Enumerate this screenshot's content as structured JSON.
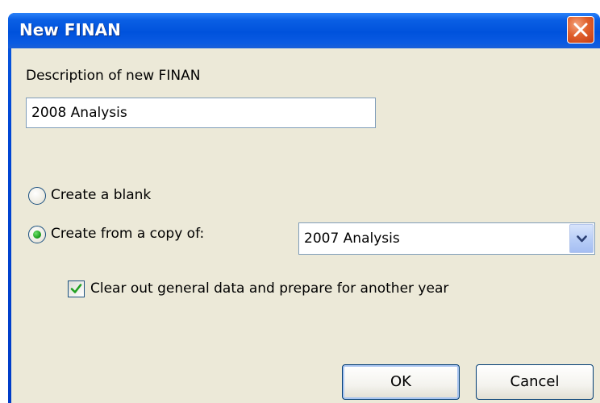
{
  "window": {
    "title": "New FINAN"
  },
  "description": {
    "label": "Description of new FINAN",
    "value": "2008 Analysis"
  },
  "options": {
    "blank_label": "Create a blank",
    "blank_selected": false,
    "copy_label": "Create from a copy of:",
    "copy_selected": true,
    "source_selected": "2007 Analysis"
  },
  "clear_option": {
    "label": "Clear out general data and prepare for another year",
    "checked": true
  },
  "buttons": {
    "ok": "OK",
    "cancel": "Cancel"
  },
  "icons": {
    "close": "close-icon",
    "dropdown": "chevron-down-icon",
    "check": "checkmark-icon"
  },
  "colors": {
    "titlebar": "#0a5fe4",
    "dialog_bg": "#ece9d8",
    "close_button": "#e0602c",
    "radio_dot": "#21a121",
    "check_mark": "#21a121"
  }
}
